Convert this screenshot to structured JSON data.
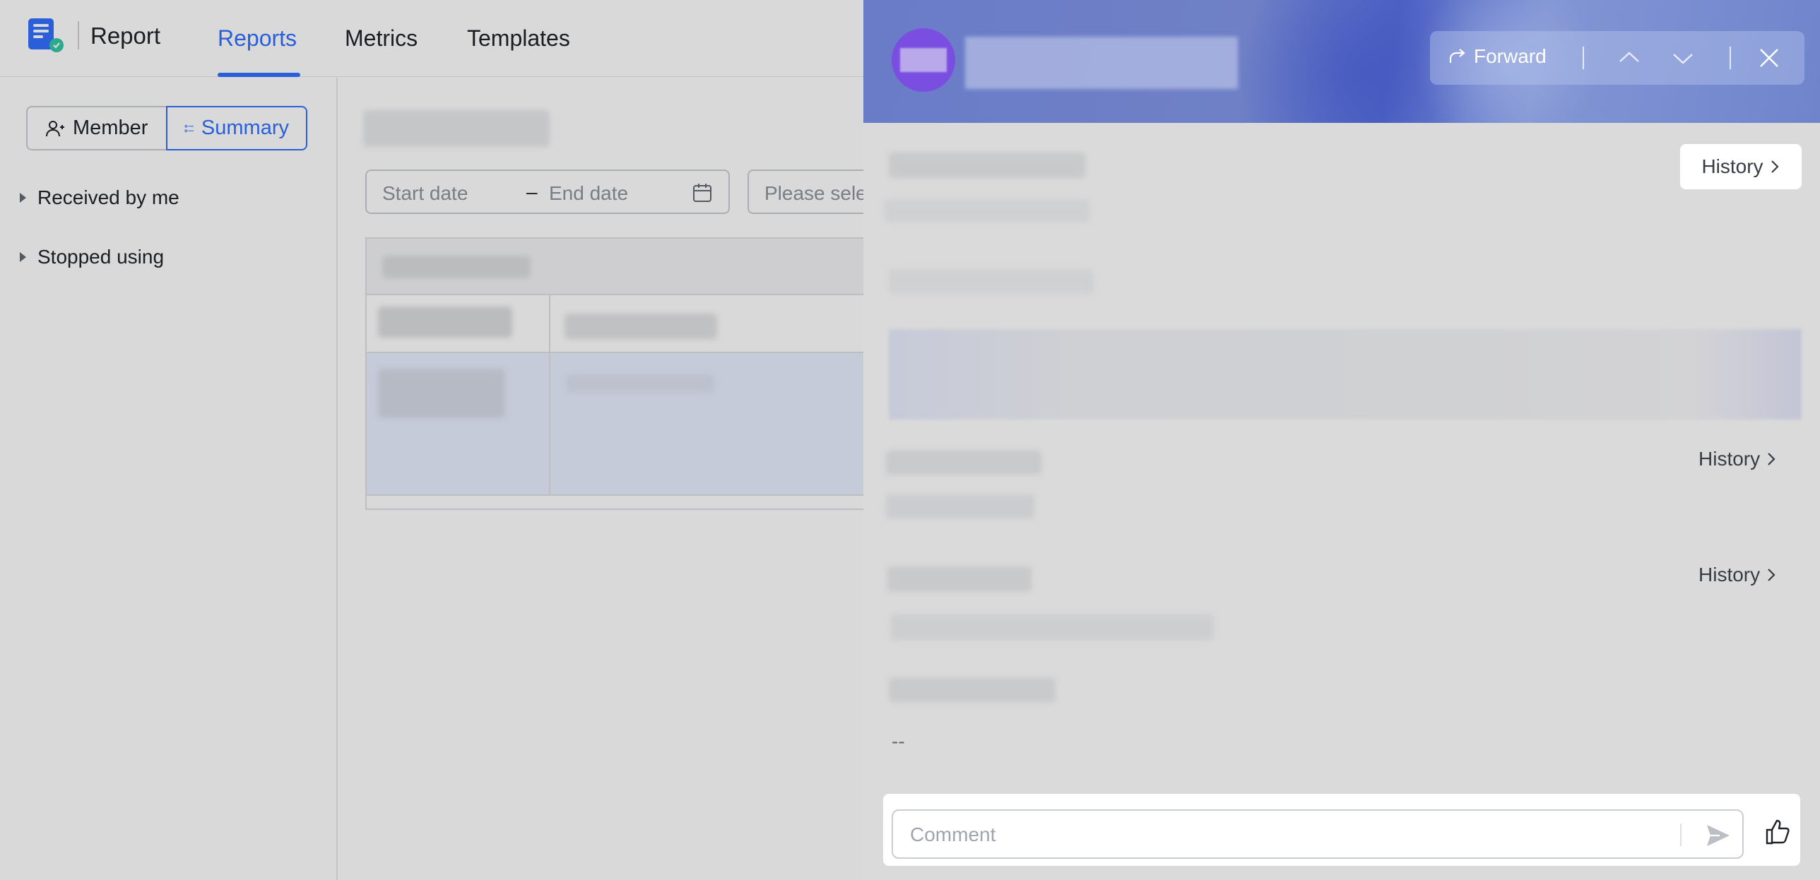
{
  "app": {
    "title": "Report",
    "nav_tabs": [
      "Reports",
      "Metrics",
      "Templates"
    ],
    "active_tab": "Reports",
    "accent_color": "#3370ff"
  },
  "sidebar": {
    "view_toggle": [
      "Member",
      "Summary"
    ],
    "active_view": "Summary",
    "tree_items": [
      "Received by me",
      "Stopped using"
    ]
  },
  "filters": {
    "start_placeholder": "Start date",
    "range_separator": "–",
    "end_placeholder": "End date",
    "select_placeholder": "Please select"
  },
  "drawer": {
    "toolbar": {
      "forward_label": "Forward",
      "icons": [
        "share-arrow-icon",
        "chevron-up-icon",
        "chevron-down-icon",
        "close-icon"
      ]
    },
    "sections": [
      {
        "history_label": "History"
      },
      {
        "history_label": "History"
      },
      {
        "history_label": "History"
      }
    ],
    "empty_value": "--",
    "comment_placeholder": "Comment",
    "footer_icons": [
      "send-icon",
      "thumbs-up-icon"
    ]
  }
}
